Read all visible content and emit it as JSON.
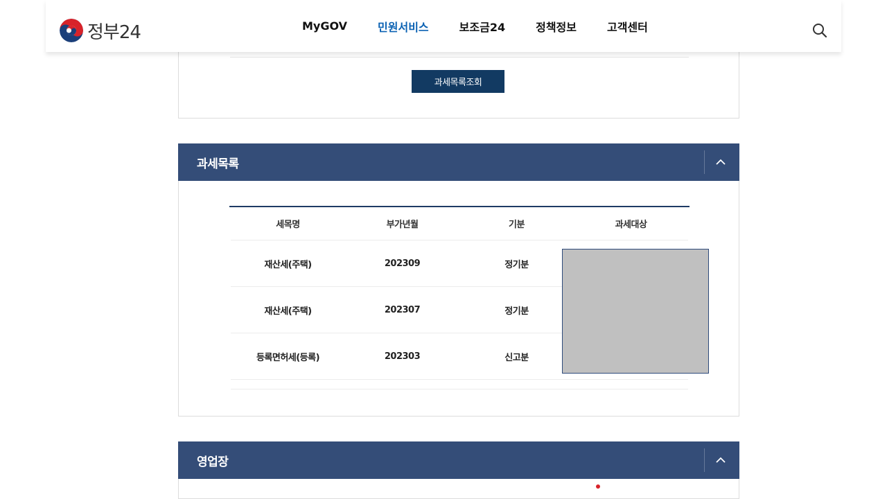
{
  "header": {
    "logo_text": "정부24",
    "nav": [
      {
        "label": "MyGOV",
        "active": false
      },
      {
        "label": "민원서비스",
        "active": true
      },
      {
        "label": "보조금24",
        "active": false
      },
      {
        "label": "정책정보",
        "active": false
      },
      {
        "label": "고객센터",
        "active": false
      }
    ],
    "icons": {
      "search": "search-icon",
      "logo": "taegeuk-logo-icon"
    }
  },
  "query_button": {
    "label": "과세목록조회"
  },
  "tax_section": {
    "title": "과세목록",
    "toggle_icon": "chevron-up-icon",
    "columns": [
      "세목명",
      "부가년월",
      "기분",
      "과세대상"
    ],
    "rows": [
      [
        "재산세(주택)",
        "202309",
        "정기분",
        ""
      ],
      [
        "재산세(주택)",
        "202307",
        "정기분",
        ""
      ],
      [
        "등록면허세(등록)",
        "202303",
        "신고분",
        ""
      ]
    ]
  },
  "business_section": {
    "title": "영업장",
    "toggle_icon": "chevron-up-icon"
  },
  "colors": {
    "brand_navy": "#344d78",
    "button_navy": "#123a62",
    "nav_active": "#0b62b3",
    "redaction": "#c0c0c0"
  }
}
